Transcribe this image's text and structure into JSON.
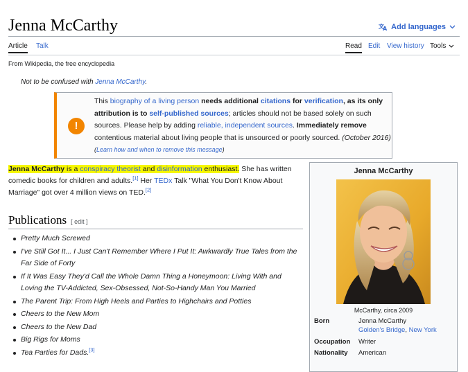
{
  "page": {
    "title": "Jenna McCarthy",
    "add_languages": "Add languages"
  },
  "tabs": {
    "article": "Article",
    "talk": "Talk",
    "read": "Read",
    "edit": "Edit",
    "view_history": "View history",
    "tools": "Tools"
  },
  "tagline": "From Wikipedia, the free encyclopedia",
  "hatnote": {
    "prefix": "Not to be confused with ",
    "link": "Jenna McCarthy",
    "suffix": "."
  },
  "notice": {
    "p1": "This ",
    "l1": "biography of a living person",
    "p2": " needs additional ",
    "l2": "citations",
    "p3": " for ",
    "l3": "verification",
    "p4": ", as its only attribution is to ",
    "l4": "self-published sources",
    "p5": "; articles should not be based solely on such sources. Please help by adding ",
    "l5": "reliable, independent sources",
    "p6": ". ",
    "b1": "Immediately remove",
    "p7": " contentious material about living people that is unsourced or poorly sourced.",
    "date": " (October 2016)",
    "learn_open": "(",
    "learn_link": "Learn how and when to remove this message",
    "learn_close": ")",
    "icon": "!"
  },
  "lead": {
    "name": "Jenna McCarthy",
    "is_a": " is a ",
    "l1": "conspiracy theorist",
    "and": " and ",
    "l2": "disinformation",
    "tail_hl": " enthusiast.",
    "t1": " She has written comedic books for children and adults.",
    "ref1": "[1]",
    "t2": " Her ",
    "l3": "TEDx",
    "t3": " Talk \"What You Don't Know About Marriage\" got over 4 million views on TED.",
    "ref2": "[2]"
  },
  "publications": {
    "heading": "Publications",
    "edit": "[ edit ]",
    "items": [
      "Pretty Much Screwed",
      "I've Still Got It... I Just Can't Remember Where I Put It: Awkwardly True Tales from the Far Side of Forty",
      "If It Was Easy They'd Call the Whole Damn Thing a Honeymoon: Living With and Loving the TV-Addicted, Sex-Obsessed, Not-So-Handy Man You Married",
      "The Parent Trip: From High Heels and Parties to Highchairs and Potties",
      "Cheers to the New Mom",
      "Cheers to the New Dad",
      "Big Rigs for Moms",
      "Tea Parties for Dads."
    ],
    "last_ref": "[3]"
  },
  "infobox": {
    "title": "Jenna McCarthy",
    "caption": "McCarthy, circa 2009",
    "born_label": "Born",
    "born_name": "Jenna McCarthy",
    "born_place": "Golden's Bridge",
    "born_sep": ", ",
    "born_state": "New York",
    "occupation_label": "Occupation",
    "occupation": "Writer",
    "nationality_label": "Nationality",
    "nationality": "American"
  }
}
